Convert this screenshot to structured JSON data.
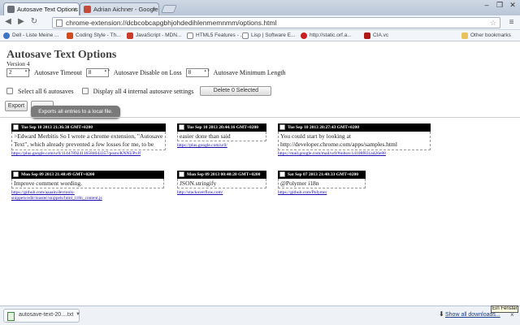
{
  "browser": {
    "tabs": [
      {
        "label": "Autosave Text Options",
        "active": true,
        "icon_color": "#6a6f78"
      },
      {
        "label": "Adrian Aichner - Google",
        "active": false,
        "icon_color": "#c44a3a"
      }
    ],
    "address": "chrome-extension://dcbcobcapgbhjohdedihlenmemnmm/options.html",
    "bookmarks": [
      {
        "label": "Dell - Liste Meine ...",
        "icon_color": "#3f74c4"
      },
      {
        "label": "Coding Style - Th...",
        "icon_color": "#d04a20"
      },
      {
        "label": "JavaScript - MDN...",
        "icon_color": "#cc3a2a"
      },
      {
        "label": "HTML5 Features - ...",
        "icon_color": "#888888"
      },
      {
        "label": "Lisp | Software E...",
        "icon_color": "#999999"
      },
      {
        "label": "http://static.orf.a...",
        "icon_color": "#c81f1f"
      },
      {
        "label": "CIA.vc",
        "icon_color": "#b01818"
      }
    ],
    "other_bookmarks": "Other bookmarks"
  },
  "options": {
    "title": "Autosave Text Options",
    "version": "Version 4",
    "timeout_value": "2",
    "timeout_label": "Autosave Timeout",
    "disable_on_loss_value": "8",
    "disable_on_loss_label": "Autosave Disable on Loss",
    "min_length_value": "8",
    "min_length_label": "Autosave Minimum Length",
    "select_all_label": "Select all 6 autosaves",
    "display_internal_label": "Display all 4 internal autosave settings",
    "delete_label": "Delete 0 Selected",
    "export_label": "Export",
    "export_tooltip": "Exports all entries to a local file."
  },
  "entries": [
    {
      "date": "Tue Sep 10 2013 21:36:38 GMT+0200",
      "text": ">Edward Merbitis So I wrote a chrome extension, \"Autosave Text\", which already prevented a few losses for me, to be",
      "url": "https://plus.google.com/u/0/114478924116584043357/posts/KNNUPvJf"
    },
    {
      "date": "Tue Sep 10 2013 20:44:16 GMT+0200",
      "text": "easier done than said",
      "url": "https://plus.google.com/u/0/"
    },
    {
      "date": "Tue Sep 10 2013 20:27:43 GMT+0200",
      "text": "You could start by looking at http://developer.chrome.com/apps/samples.html",
      "url": "https://mail.google.com/mail/u/0/#inbox/14108f831ad26e88"
    },
    {
      "date": "Mon Sep 09 2013 21:48:49 GMT+0200",
      "text": "Improve comment wording.",
      "url": "https://github.com/aaaain/devtools-snippets/edit/master/snippets/html_i18n_content.js"
    },
    {
      "date": "Mon Sep 09 2013 00:40:20 GMT+0200",
      "text": "JSON.stringify",
      "url": "http://stackoverflow.com/"
    },
    {
      "date": "Sat Sep 07 2013 21:40:33 GMT+0200",
      "text": "@Polymer i18n",
      "url": "https://github.com/Polymer"
    }
  ],
  "downloads": {
    "file_name": "autosave-text-20....txt",
    "show_all": "Show all downloads...",
    "corner_tooltip": "Ein Fenster s"
  }
}
